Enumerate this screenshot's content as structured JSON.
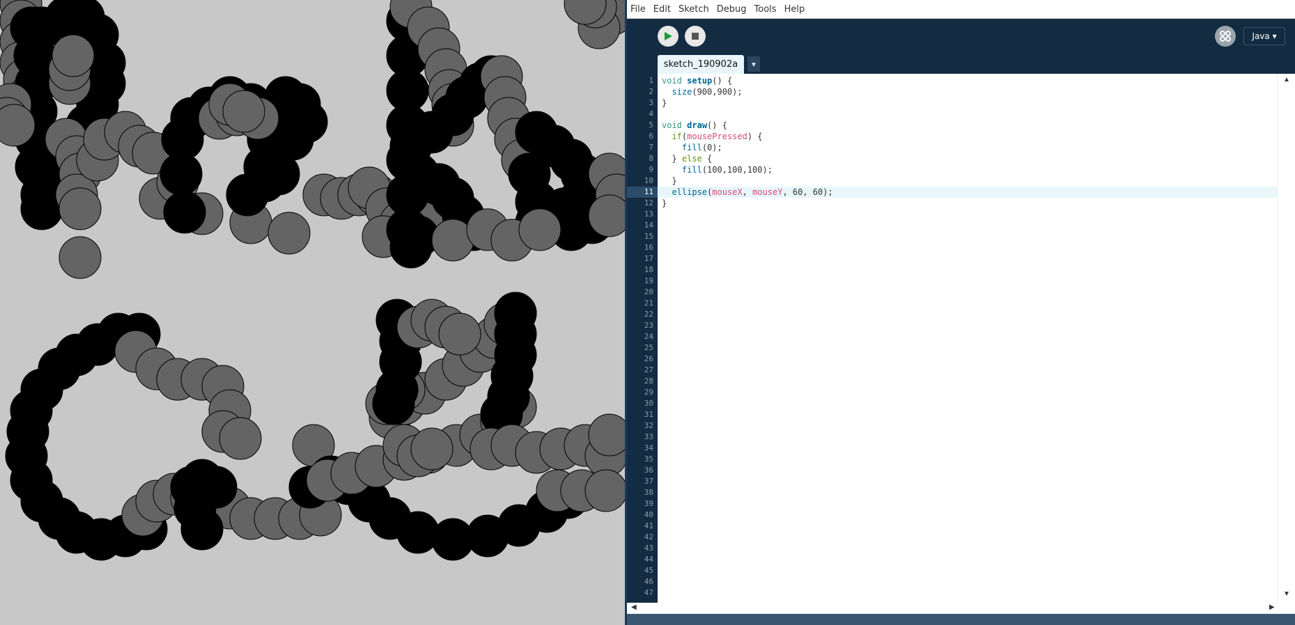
{
  "sketch_window": {
    "background": "#c8c8c8",
    "dot_gray": "#646464",
    "dot_black": "#000000"
  },
  "menu": [
    "File",
    "Edit",
    "Sketch",
    "Debug",
    "Tools",
    "Help"
  ],
  "toolbar": {
    "run_icon": "play-icon",
    "stop_icon": "stop-icon",
    "debug_icon": "butterfly-icon",
    "mode": "Java ▾"
  },
  "tab": {
    "name": "sketch_190902a",
    "menu_glyph": "▾"
  },
  "editor": {
    "current_line": 11,
    "line_count": 47,
    "lines": [
      "void setup() {",
      "  size(900,900);",
      "}",
      "",
      "void draw() {",
      "  if(mousePressed) {",
      "    fill(0);",
      "  } else {",
      "    fill(100,100,100);",
      "  }",
      "  ellipse(mouseX, mouseY, 60, 60);",
      "}"
    ]
  },
  "colors": {
    "ide_bg": "#142c42",
    "tab_active": "#e8f6f9",
    "keyword_type": "#33997e",
    "function": "#006699",
    "variable": "#d94a7a",
    "control": "#669900"
  }
}
